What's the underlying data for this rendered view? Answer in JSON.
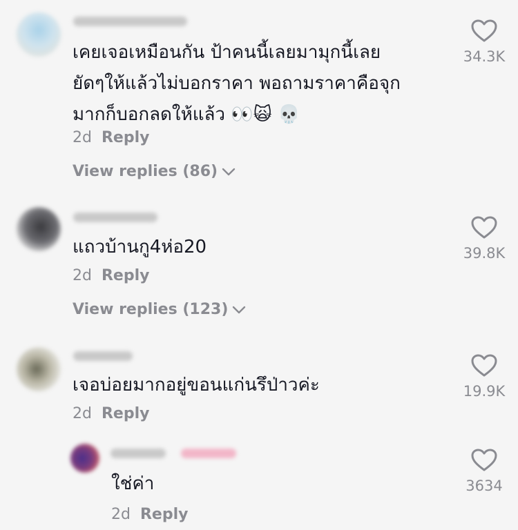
{
  "comments": [
    {
      "body_lines": [
        "เคยเจอเหมือนกัน ป้าคนนี้เลยมามุกนี้เลย",
        "ยัดๆให้แล้วไม่บอกราคา พอถามราคาคือจุก",
        "มากก็บอกลดให้แล้ว"
      ],
      "emojis": "👀🙀 💀",
      "age": "2d",
      "reply_label": "Reply",
      "view_replies": "View replies (86)",
      "likes": "34.3K"
    },
    {
      "body_lines": [
        "แถวบ้านกู4ห่อ20"
      ],
      "age": "2d",
      "reply_label": "Reply",
      "view_replies": "View replies (123)",
      "likes": "39.8K"
    },
    {
      "body_lines": [
        "เจอบ่อยมากอยู่ขอนแก่นรึป่าวค่ะ"
      ],
      "age": "2d",
      "reply_label": "Reply",
      "likes": "19.9K"
    }
  ],
  "reply": {
    "body": "ใช่ค่า",
    "age": "2d",
    "reply_label": "Reply",
    "likes": "3634"
  },
  "colors": {
    "background": "#f5f5f5",
    "text": "#161823",
    "muted": "#8a8b91"
  }
}
